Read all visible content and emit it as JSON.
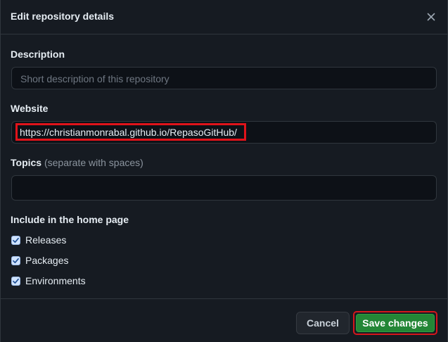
{
  "dialog": {
    "title": "Edit repository details",
    "close_icon": "close-icon"
  },
  "description": {
    "label": "Description",
    "value": "",
    "placeholder": "Short description of this repository"
  },
  "website": {
    "label": "Website",
    "value": "https://christianmonrabal.github.io/RepasoGitHub/",
    "highlight_color": "#e0131a"
  },
  "topics": {
    "label": "Topics",
    "hint": "(separate with spaces)",
    "value": ""
  },
  "home_page": {
    "label": "Include in the home page",
    "options": [
      {
        "label": "Releases",
        "checked": true
      },
      {
        "label": "Packages",
        "checked": true
      },
      {
        "label": "Environments",
        "checked": true
      }
    ]
  },
  "footer": {
    "cancel_label": "Cancel",
    "save_label": "Save changes"
  },
  "colors": {
    "background": "#161b22",
    "input_background": "#0d1117",
    "border": "#30363d",
    "primary_button": "#238636",
    "annotation_red": "#e0131a"
  }
}
